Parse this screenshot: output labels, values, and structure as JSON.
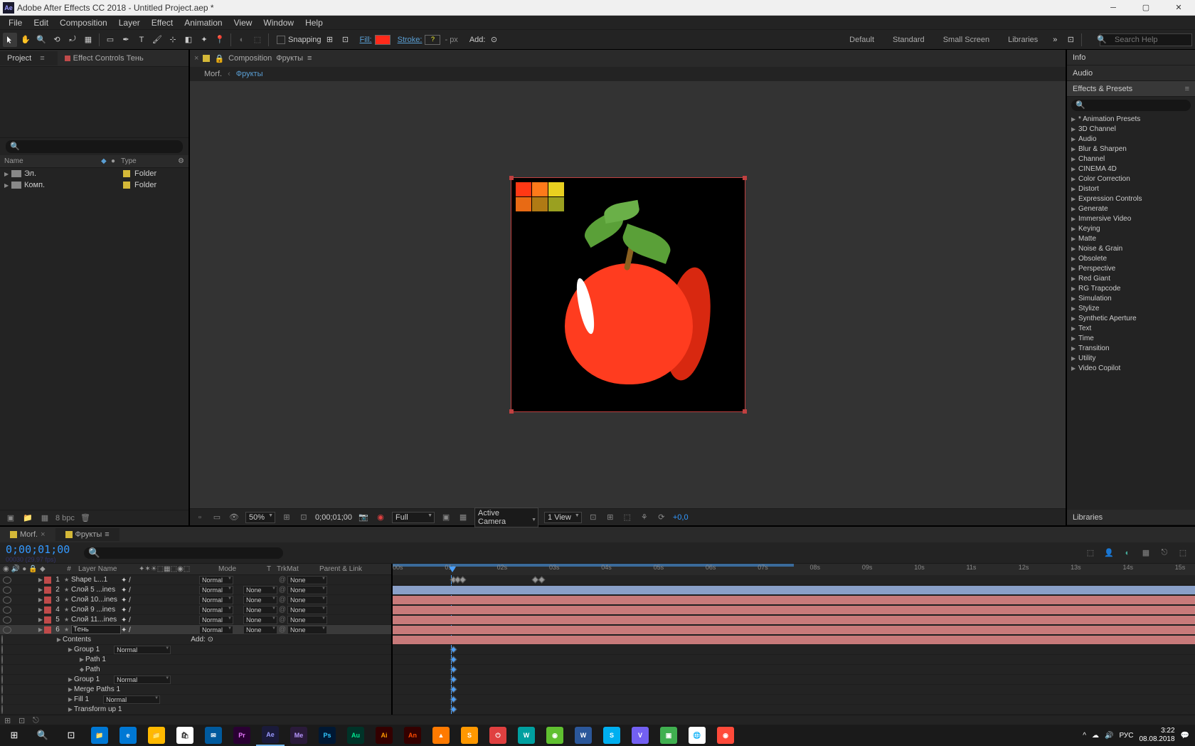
{
  "title": "Adobe After Effects CC 2018 - Untitled Project.aep *",
  "menu": [
    "File",
    "Edit",
    "Composition",
    "Layer",
    "Effect",
    "Animation",
    "View",
    "Window",
    "Help"
  ],
  "toolbar": {
    "snapping": "Snapping",
    "fill_label": "Fill:",
    "fill_color": "#ff2a1a",
    "stroke_label": "Stroke:",
    "stroke_val": "?",
    "px": "- px",
    "add": "Add:",
    "workspaces": [
      "Default",
      "Standard",
      "Small Screen",
      "Libraries"
    ],
    "search_ph": "Search Help"
  },
  "left": {
    "project_tab": "Project",
    "fx_tab": "Effect Controls Тень",
    "cols": {
      "name": "Name",
      "type": "Type"
    },
    "rows": [
      {
        "name": "Эл.",
        "type": "Folder"
      },
      {
        "name": "Комп.",
        "type": "Folder"
      }
    ],
    "bpc": "8 bpc"
  },
  "center": {
    "comp_label": "Composition",
    "comp_link": "Фрукты",
    "bc1": "Morf.",
    "bc2": "Фрукты",
    "zoom": "50%",
    "time": "0;00;01;00",
    "res": "Full",
    "camera": "Active Camera",
    "view": "1 View",
    "exp": "+0,0",
    "swatches": [
      "#ff3814",
      "#ff7a1a",
      "#e8d020",
      "#e86a14",
      "#b07a14",
      "#9aa020"
    ]
  },
  "right": {
    "info": "Info",
    "audio": "Audio",
    "ep": "Effects & Presets",
    "lib": "Libraries",
    "ep_items": [
      "* Animation Presets",
      "3D Channel",
      "Audio",
      "Blur & Sharpen",
      "Channel",
      "CINEMA 4D",
      "Color Correction",
      "Distort",
      "Expression Controls",
      "Generate",
      "Immersive Video",
      "Keying",
      "Matte",
      "Noise & Grain",
      "Obsolete",
      "Perspective",
      "Red Giant",
      "RG Trapcode",
      "Simulation",
      "Stylize",
      "Synthetic Aperture",
      "Text",
      "Time",
      "Transition",
      "Utility",
      "Video Copilot"
    ]
  },
  "timeline": {
    "tabs": [
      {
        "name": "Morf."
      },
      {
        "name": "Фрукты"
      }
    ],
    "time": "0;00;01;00",
    "sub": "00030 (29.97 fps)",
    "cols": {
      "num": "#",
      "name": "Layer Name",
      "mode": "Mode",
      "t": "T",
      "trk": "TrkMat",
      "par": "Parent & Link"
    },
    "add": "Add:",
    "layers": [
      {
        "n": "1",
        "name": "Shape L...1",
        "mode": "Normal",
        "trk": "",
        "par": "None",
        "tag": "#c04a4a",
        "bar": "#8aa0c8"
      },
      {
        "n": "2",
        "name": "Слой 5 ...ines",
        "mode": "Normal",
        "trk": "None",
        "par": "None",
        "tag": "#c04a4a",
        "bar": "#c87a7a"
      },
      {
        "n": "3",
        "name": "Слой 10...ines",
        "mode": "Normal",
        "trk": "None",
        "par": "None",
        "tag": "#c04a4a",
        "bar": "#c87a7a"
      },
      {
        "n": "4",
        "name": "Слой 9 ...ines",
        "mode": "Normal",
        "trk": "None",
        "par": "None",
        "tag": "#c04a4a",
        "bar": "#c87a7a"
      },
      {
        "n": "5",
        "name": "Слой 11...ines",
        "mode": "Normal",
        "trk": "None",
        "par": "None",
        "tag": "#c04a4a",
        "bar": "#c87a7a"
      },
      {
        "n": "6",
        "name": "Тень",
        "mode": "Normal",
        "trk": "None",
        "par": "None",
        "tag": "#c04a4a",
        "bar": "#c87a7a",
        "sel": true
      }
    ],
    "sub_rows": [
      {
        "indent": 1,
        "name": "Contents",
        "extra": "Add:"
      },
      {
        "indent": 2,
        "name": "Group 1",
        "mode": "Normal"
      },
      {
        "indent": 3,
        "name": "Path 1"
      },
      {
        "indent": 3,
        "name": "Path",
        "kf": true
      },
      {
        "indent": 2,
        "name": "Group 1",
        "mode": "Normal"
      },
      {
        "indent": 2,
        "name": "Merge Paths 1"
      },
      {
        "indent": 2,
        "name": "Fill 1",
        "mode": "Normal"
      },
      {
        "indent": 2,
        "name": "Transform  up 1"
      }
    ],
    "ruler": [
      "00s",
      "01s",
      "02s",
      "03s",
      "04s",
      "05s",
      "06s",
      "07s",
      "08s",
      "09s",
      "10s",
      "11s",
      "12s",
      "13s",
      "14s",
      "15s"
    ]
  },
  "taskbar": {
    "lang": "РУС",
    "time": "3:22",
    "date": "08.08.2018"
  }
}
